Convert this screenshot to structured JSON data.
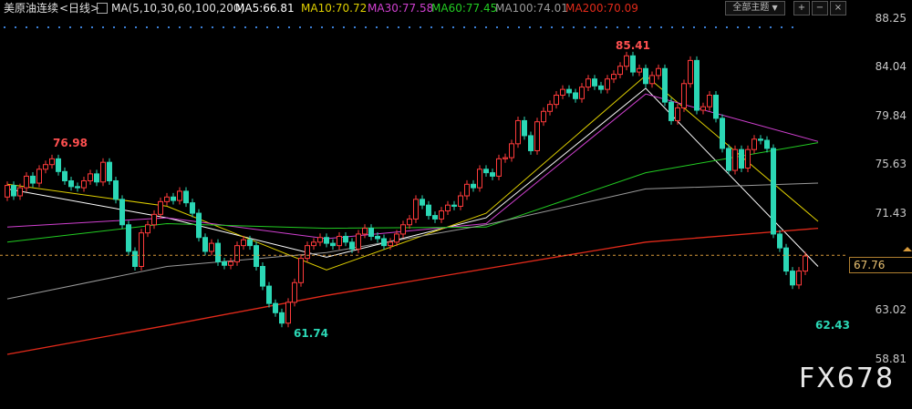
{
  "header": {
    "instrument": "美原油连续",
    "period": "<日线>",
    "ma_set": "MA(5,10,30,60,100,200)",
    "ma5": "MA5:66.81",
    "ma10": "MA10:70.72",
    "ma30": "MA30:77.58",
    "ma60": "MA60:77.45",
    "ma100": "MA100:74.01",
    "ma200": "MA200:70.09",
    "theme_button": "全部主题"
  },
  "labels": {
    "high": "85.41",
    "low": "61.74",
    "left_high": "76.98",
    "recent_low": "62.43",
    "current": "67.76",
    "watermark": "FX678"
  },
  "colors": {
    "up": "#ff3b3b",
    "down": "#2bd7b5",
    "ma5": "#ffffff",
    "ma10": "#e0d000",
    "ma30": "#d040d0",
    "ma60": "#22cc22",
    "ma100": "#9a9a9a",
    "ma200": "#e22a1a",
    "price_line": "#d89a3a"
  },
  "chart_data": {
    "type": "candlestick",
    "y_ticks": [
      "88.25",
      "84.04",
      "79.84",
      "75.63",
      "71.43",
      "67.23",
      "63.02",
      "58.81"
    ],
    "ylim": [
      58.81,
      88.25
    ],
    "current_price": 67.76,
    "annotations": [
      {
        "text": "85.41",
        "value": 85.41
      },
      {
        "text": "61.74",
        "value": 61.74
      },
      {
        "text": "76.98",
        "value": 76.98
      },
      {
        "text": "62.43",
        "value": 62.43
      }
    ],
    "close": [
      73.8,
      72.9,
      73.6,
      74.6,
      74.0,
      75.2,
      75.6,
      76.1,
      75.0,
      74.2,
      73.7,
      73.6,
      74.2,
      74.8,
      74.1,
      75.8,
      74.2,
      72.6,
      70.4,
      68.1,
      66.8,
      69.7,
      70.4,
      71.3,
      72.4,
      72.8,
      72.5,
      73.3,
      72.3,
      71.4,
      69.3,
      68.1,
      68.8,
      67.2,
      66.9,
      67.2,
      68.6,
      69.1,
      68.6,
      66.8,
      65.1,
      63.6,
      62.8,
      61.9,
      63.7,
      65.4,
      67.5,
      68.6,
      68.9,
      69.3,
      68.8,
      68.6,
      69.4,
      68.9,
      68.3,
      69.6,
      70.1,
      69.4,
      69.2,
      68.6,
      68.9,
      69.6,
      70.4,
      70.9,
      72.6,
      72.1,
      71.2,
      70.9,
      71.6,
      72.1,
      72.0,
      72.9,
      73.9,
      73.6,
      75.2,
      74.9,
      74.6,
      76.1,
      76.2,
      77.4,
      79.4,
      78.1,
      76.8,
      79.3,
      80.2,
      80.8,
      81.6,
      82.1,
      81.8,
      81.3,
      82.3,
      83.0,
      82.4,
      82.1,
      83.0,
      83.4,
      84.1,
      85.0,
      83.6,
      83.9,
      82.6,
      83.3,
      83.9,
      81.0,
      79.4,
      80.5,
      82.6,
      84.6,
      80.3,
      80.6,
      81.6,
      79.6,
      77.0,
      75.1,
      76.9,
      75.3,
      76.9,
      77.8,
      77.7,
      77.0,
      69.6,
      68.4,
      66.4,
      65.2,
      66.4,
      67.7
    ],
    "open": [
      72.8,
      73.8,
      72.9,
      73.6,
      74.6,
      74.0,
      75.2,
      75.6,
      76.1,
      75.0,
      74.2,
      73.7,
      73.6,
      74.2,
      74.8,
      74.1,
      75.8,
      74.2,
      72.6,
      70.4,
      68.1,
      66.8,
      69.7,
      70.4,
      71.3,
      72.4,
      72.8,
      72.5,
      73.3,
      72.3,
      71.4,
      69.3,
      68.1,
      68.8,
      67.2,
      66.9,
      67.2,
      68.6,
      69.1,
      68.6,
      66.8,
      65.1,
      63.6,
      62.8,
      61.9,
      63.7,
      65.4,
      67.5,
      68.6,
      68.9,
      69.3,
      68.8,
      68.6,
      69.4,
      68.9,
      68.3,
      69.6,
      70.1,
      69.4,
      69.2,
      68.6,
      68.9,
      69.6,
      70.4,
      70.9,
      72.6,
      72.1,
      71.2,
      70.9,
      71.6,
      72.1,
      72.0,
      72.9,
      73.9,
      73.6,
      75.2,
      74.9,
      74.6,
      76.1,
      76.2,
      77.4,
      79.4,
      78.1,
      76.8,
      79.3,
      80.2,
      80.8,
      81.6,
      82.1,
      81.8,
      81.3,
      82.3,
      83.0,
      82.4,
      82.1,
      83.0,
      83.4,
      84.1,
      85.0,
      83.6,
      83.9,
      82.6,
      83.3,
      83.9,
      81.0,
      79.4,
      80.5,
      82.6,
      84.6,
      80.3,
      80.6,
      81.6,
      79.6,
      77.0,
      75.1,
      76.9,
      75.3,
      76.9,
      77.8,
      77.7,
      77.0,
      69.6,
      68.4,
      66.4,
      65.2,
      66.4
    ],
    "ma_series": [
      {
        "name": "MA5",
        "key": "ma5",
        "x": [
          0,
          25,
          50,
          75,
          100,
          127
        ],
        "values": [
          73.5,
          71.0,
          67.6,
          71.0,
          82.2,
          66.8
        ]
      },
      {
        "name": "MA10",
        "key": "ma10",
        "x": [
          0,
          25,
          50,
          75,
          100,
          127
        ],
        "values": [
          73.9,
          72.0,
          66.5,
          71.4,
          83.3,
          70.7
        ]
      },
      {
        "name": "MA30",
        "key": "ma30",
        "x": [
          0,
          25,
          50,
          75,
          100,
          127
        ],
        "values": [
          70.2,
          71.0,
          69.2,
          70.5,
          81.7,
          77.6
        ]
      },
      {
        "name": "MA60",
        "key": "ma60",
        "x": [
          0,
          25,
          50,
          75,
          100,
          127
        ],
        "values": [
          68.9,
          70.5,
          70.1,
          70.2,
          74.9,
          77.5
        ]
      },
      {
        "name": "MA100",
        "key": "ma100",
        "x": [
          0,
          25,
          50,
          75,
          100,
          127
        ],
        "values": [
          64.0,
          66.8,
          68.0,
          70.4,
          73.5,
          74.0
        ]
      },
      {
        "name": "MA200",
        "key": "ma200",
        "x": [
          0,
          25,
          50,
          75,
          100,
          127
        ],
        "values": [
          59.2,
          61.7,
          64.3,
          66.6,
          68.9,
          70.1
        ]
      }
    ]
  }
}
